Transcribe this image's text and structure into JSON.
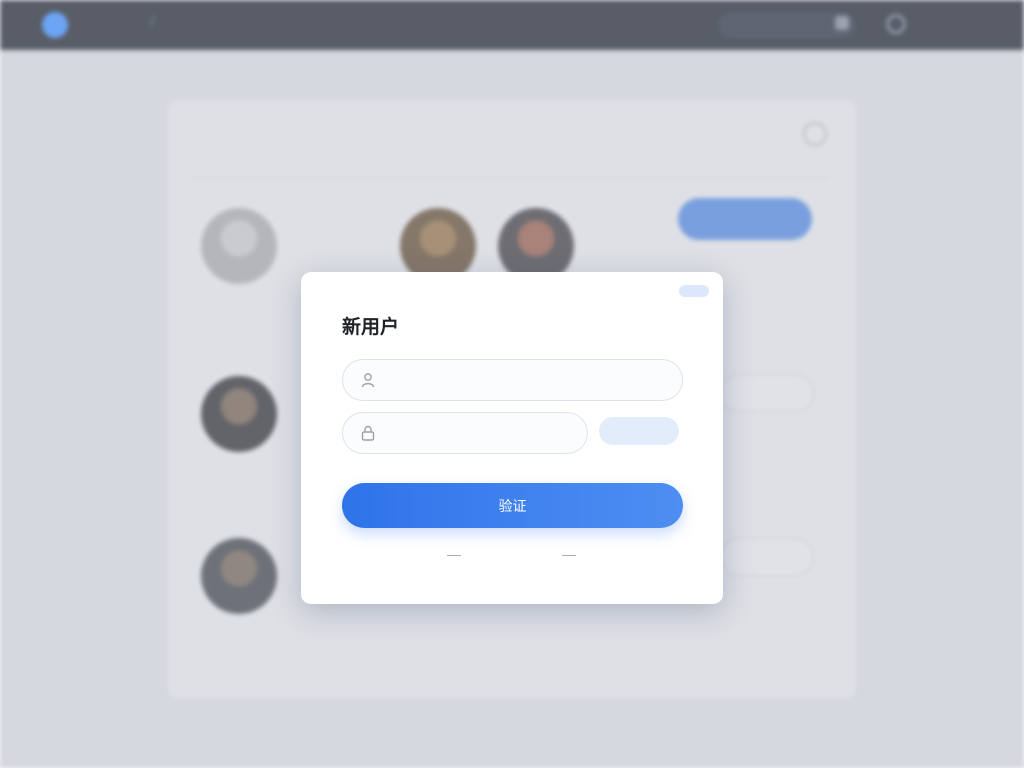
{
  "colors": {
    "accent": "#2f73ea",
    "topbar": "#1c2331",
    "link": "#3f74d6"
  },
  "icons": {
    "logo": "logo-icon",
    "search": "search-icon",
    "user_field": "user-icon",
    "password_field": "lock-icon",
    "help": "help-icon"
  },
  "topbar": {
    "logo_text": "",
    "nav_1": "",
    "nav_2": "",
    "user_name": ""
  },
  "background": {
    "breadcrumb": "",
    "breadcrumb_right": "",
    "card_title": "",
    "card_subtitle": "",
    "link_label": "",
    "primary_button": "",
    "side_text": "",
    "outline_button_1": "",
    "outline_button_2": "",
    "warning_text": "",
    "bottom_left_text": "",
    "bottom_right_text": ""
  },
  "modal": {
    "title": "新用户",
    "username_placeholder": "",
    "password_placeholder": "",
    "code_button": "",
    "forgot_link": "",
    "submit_label": "验证",
    "footer_prefix": "",
    "footer_link": ""
  }
}
